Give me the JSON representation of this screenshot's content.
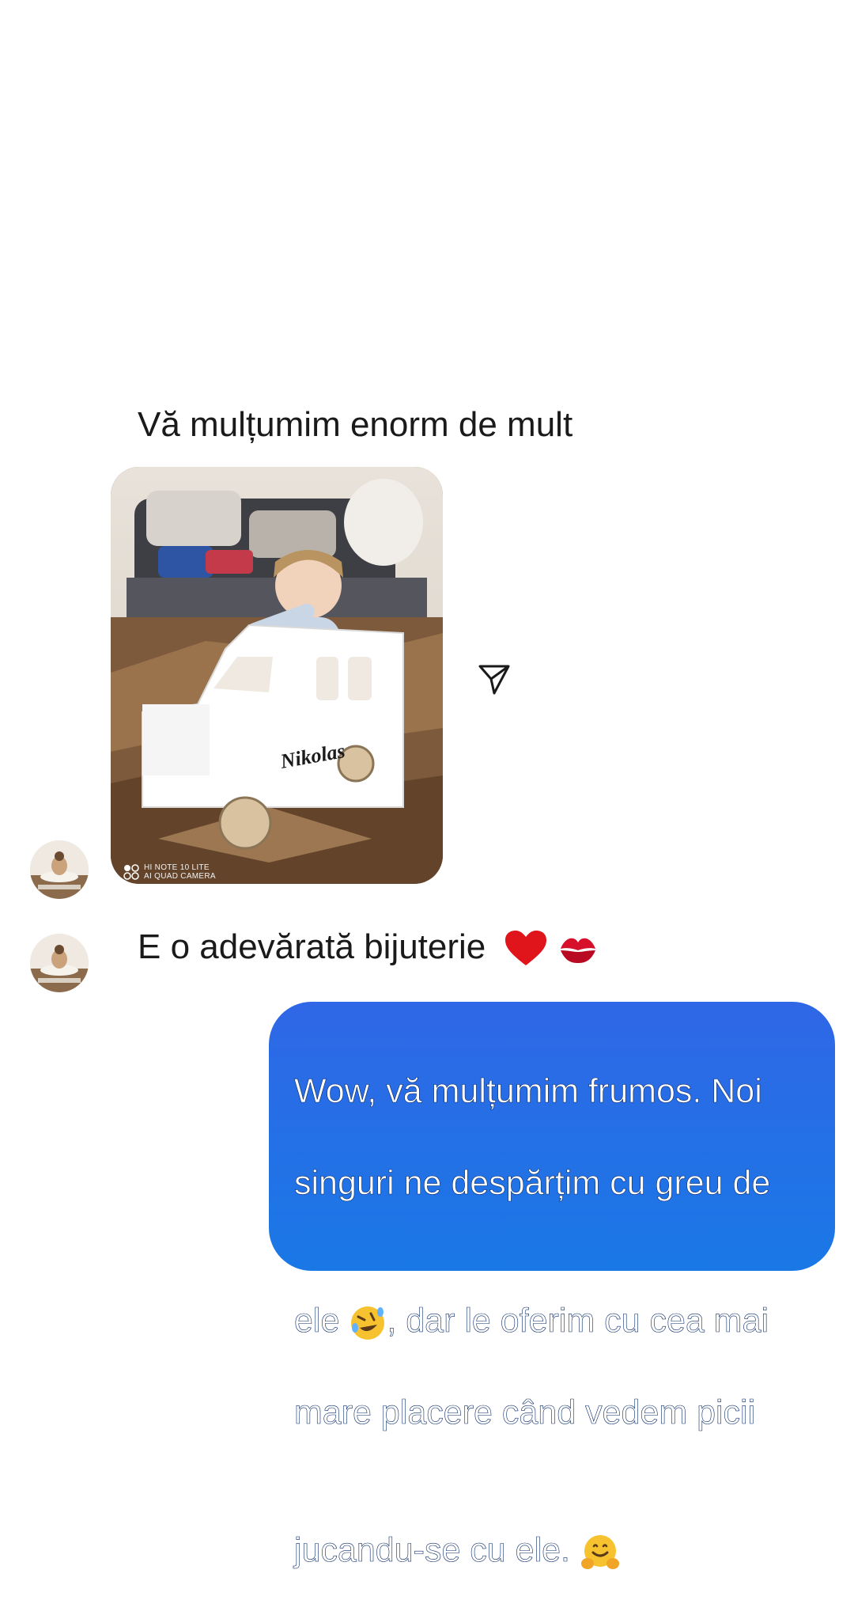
{
  "conversation": {
    "messages": [
      {
        "sender": "contact",
        "type": "text",
        "text": "Vă mulțumim enorm de mult"
      },
      {
        "sender": "contact",
        "type": "image",
        "image_text": "Nikolas",
        "watermark_lines": [
          "HI NOTE 10 LITE",
          "AI QUAD CAMERA"
        ]
      },
      {
        "sender": "contact",
        "type": "text",
        "text": "E o adevărată bijuterie",
        "emojis": [
          "red-heart",
          "kiss-mark"
        ]
      },
      {
        "sender": "me",
        "type": "text",
        "text_parts": [
          "Wow, vă mulțumim frumos. Noi singuri ne despărțim cu greu de ele ",
          ", dar le oferim cu cea mai mare placere când vedem picii jucandu-se cu ele. "
        ],
        "emojis": [
          "rolling-on-floor-laughing",
          "hugging-face"
        ]
      }
    ],
    "bubble_lines": [
      "Wow, vă mulțumim frumos. Noi",
      "singuri ne despărțim cu greu de",
      "ele ",
      ", dar le oferim cu cea mai",
      "mare placere când vedem picii",
      "jucandu-se cu ele. "
    ]
  },
  "icons": {
    "share": "send-paper-plane-icon",
    "avatar": "contact-avatar"
  },
  "colors": {
    "bubble_top": "#2f67e6",
    "bubble_bottom": "#1a78e6",
    "text": "#1a1a1a",
    "background": "#ffffff"
  }
}
